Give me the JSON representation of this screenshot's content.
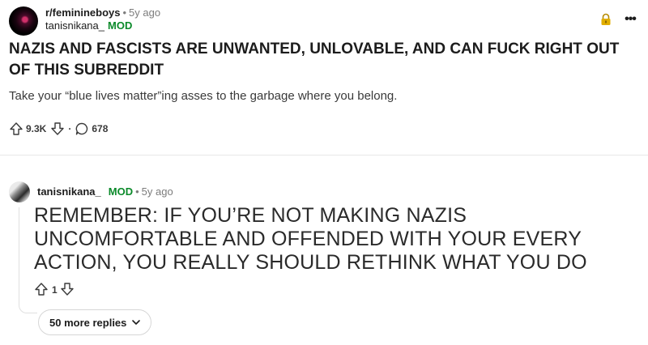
{
  "post": {
    "subreddit": "r/feminineboys",
    "separator": "•",
    "time": "5y ago",
    "author": "tanisnikana_",
    "author_badge": "MOD",
    "title": "NAZIS AND FASCISTS ARE UNWANTED, UNLOVABLE, AND CAN FUCK RIGHT OUT OF THIS SUBREDDIT",
    "body": "Take your “blue lives matter”ing asses to the garbage where you belong.",
    "score": "9.3K",
    "dot": "·",
    "comments": "678",
    "lock_icon": "lock-icon",
    "more_icon": "more-options-icon",
    "more_glyph": "•••"
  },
  "comment": {
    "author": "tanisnikana_",
    "author_badge": "MOD",
    "separator": "•",
    "time": "5y ago",
    "text": "REMEMBER: IF YOU’RE NOT MAKING NAZIS UNCOMFORTABLE AND OFFENDED WITH YOUR EVERY ACTION, YOU REALLY SHOULD RETHINK WHAT YOU DO",
    "score": "1",
    "more_replies_label": "50 more replies"
  },
  "colors": {
    "mod_badge": "#0b8a2a",
    "lock": "#d8a400",
    "text": "#1c1c1c",
    "meta": "#7c7c7c"
  }
}
